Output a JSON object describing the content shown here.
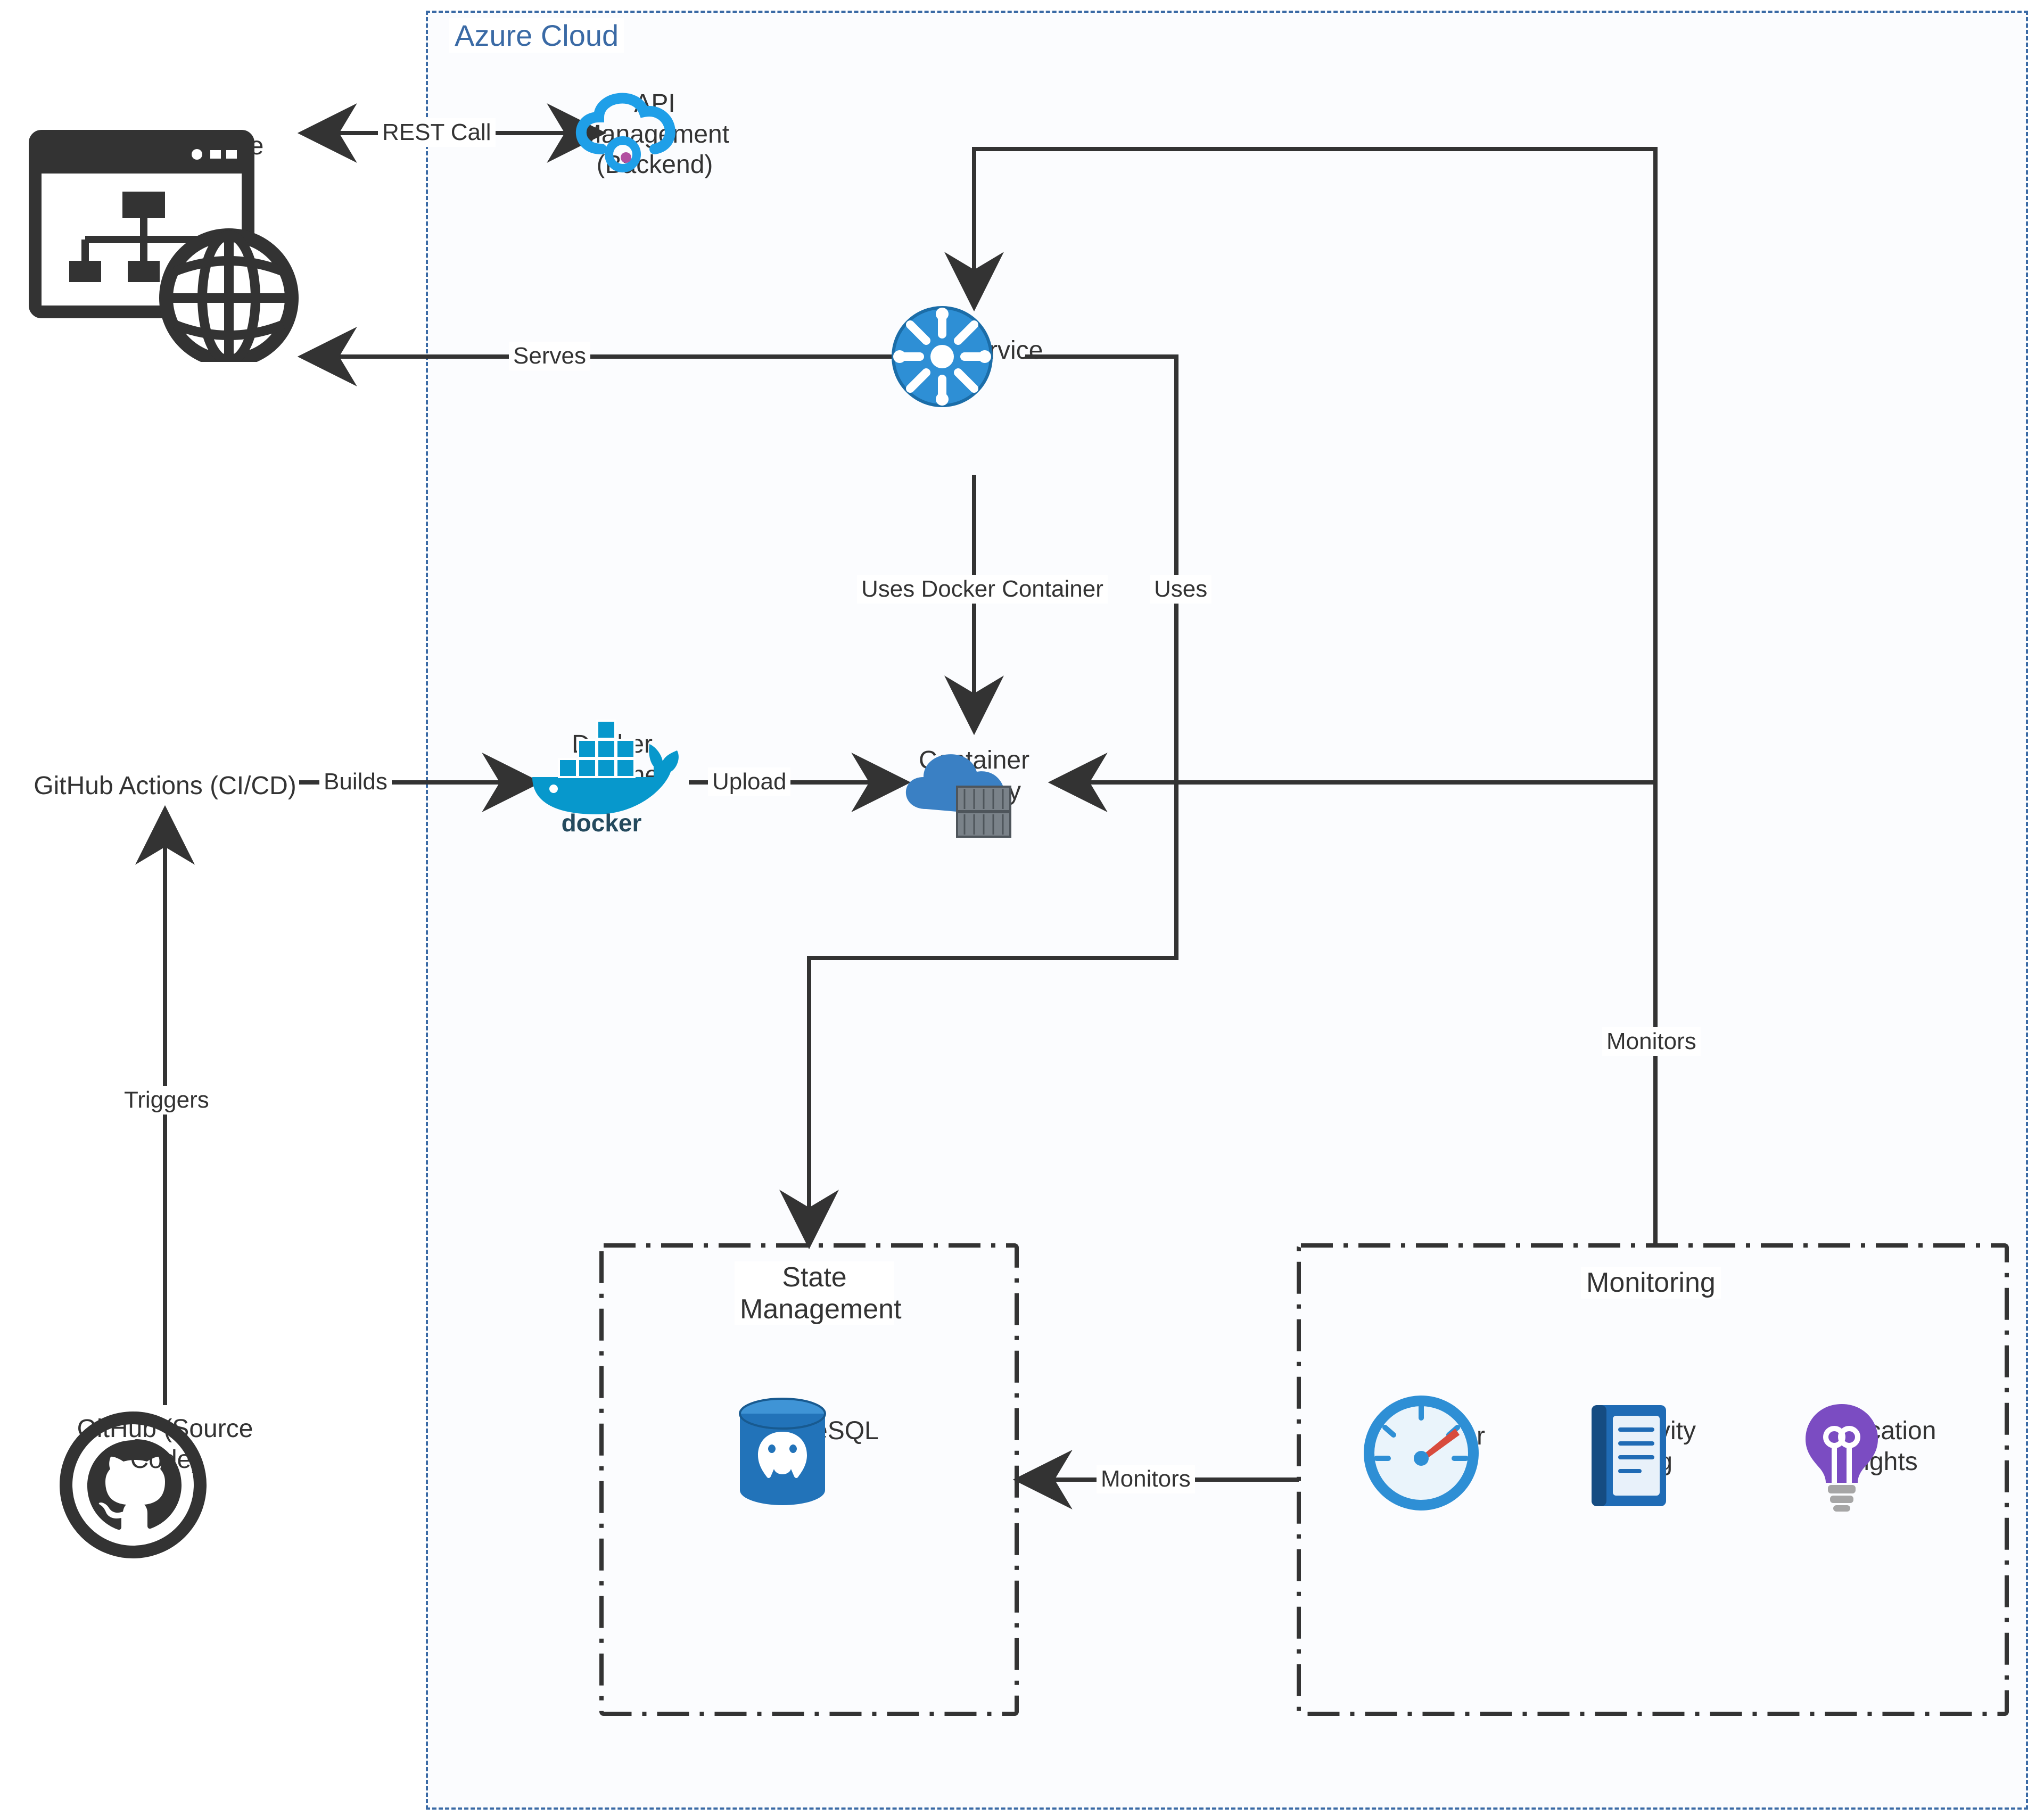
{
  "groups": {
    "azure": {
      "title": "Azure Cloud"
    },
    "state": {
      "title": "State\nManagement"
    },
    "monitoring": {
      "title": "Monitoring"
    }
  },
  "nodes": {
    "mendix": {
      "label": "Mendix Website"
    },
    "apim": {
      "label": "API\nManagement\n(Backend)"
    },
    "appsvc": {
      "label": "App Service"
    },
    "ghactions": {
      "label": "GitHub Actions (CI/CD)"
    },
    "docker": {
      "label": "Docker\nContainer"
    },
    "registry": {
      "label": "Container\nRegistry"
    },
    "ghsrc": {
      "label": "GitHub (Source Code)"
    },
    "postgres": {
      "label": "PostgreSQL"
    },
    "monitor": {
      "label": "Monitor"
    },
    "activity": {
      "label": "Activity\nlog"
    },
    "appins": {
      "label": "Application\nInsights"
    }
  },
  "edges": {
    "rest": {
      "label": "REST Call"
    },
    "serves": {
      "label": "Serves"
    },
    "usesdocker": {
      "label": "Uses Docker Container"
    },
    "uses": {
      "label": "Uses"
    },
    "builds": {
      "label": "Builds"
    },
    "upload": {
      "label": "Upload"
    },
    "triggers": {
      "label": "Triggers"
    },
    "monitors1": {
      "label": "Monitors"
    },
    "monitors2": {
      "label": "Monitors"
    }
  },
  "colors": {
    "azureBlue": "#1f6bb5",
    "darkGray": "#333333",
    "dockerBlue": "#0798cc",
    "dockerDark": "#244a5e",
    "pgBlue": "#2273b9",
    "bookBlue": "#1f6bb5",
    "monitorBlue": "#2e8fd5",
    "insightPurple": "#7b4cc2"
  }
}
